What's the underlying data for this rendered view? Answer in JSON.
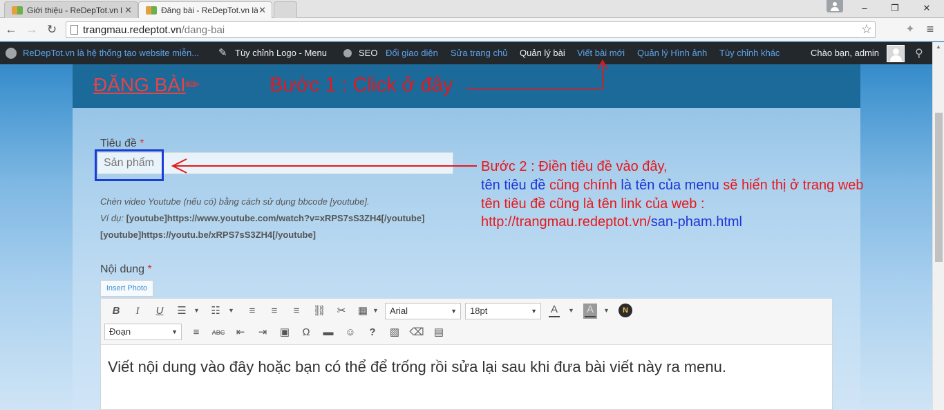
{
  "browser": {
    "tabs": [
      {
        "title": "Giới thiệu - ReDepTot.vn l"
      },
      {
        "title": "Đăng bài - ReDepTot.vn là"
      }
    ],
    "tab_close_glyph": "✕",
    "window_controls": {
      "minimize": "–",
      "restore": "❐",
      "close": "✕"
    },
    "url_host": "trangmau.redeptot.vn",
    "url_path": "/dang-bai"
  },
  "adminbar": {
    "site": "ReDepTot.vn là hệ thống tạo website miễn...",
    "logo_menu": "Tùy chỉnh Logo - Menu",
    "seo": "SEO",
    "theme": "Đổi giao diện",
    "edit_home": "Sửa trang chủ",
    "manage_posts": "Quản lý bài",
    "new_post": "Viết bài mới",
    "images": "Quản lý Hình ảnh",
    "other": "Tùy chỉnh khác",
    "greeting": "Chào bạn, admin"
  },
  "page": {
    "title": "ĐĂNG BÀI",
    "step1": "Bước 1 : Click ở đây"
  },
  "form": {
    "title_label": "Tiêu đề",
    "required_mark": "*",
    "title_placeholder": "Sản phẩm",
    "hint_line1": "Chèn video Youtube (nếu có) bằng cách sử dụng bbcode [youtube].",
    "hint_line2_prefix": "Ví dụ:",
    "hint_line2_code": "[youtube]https://www.youtube.com/watch?v=xRPS7sS3ZH4[/youtube]",
    "hint_line3_code": "[youtube]https://youtu.be/xRPS7sS3ZH4[/youtube]",
    "content_label": "Nội dung",
    "insert_photo": "Insert Photo"
  },
  "annotation": {
    "step2_line1": "Bước 2 : Điền tiêu đề vào đây,",
    "line2": [
      {
        "text": "tên tiêu đề",
        "color": "blue"
      },
      {
        "text": " cũng chính ",
        "color": "red"
      },
      {
        "text": "là tên của menu",
        "color": "blue"
      },
      {
        "text": " sẽ hiển thị ở trang web",
        "color": "red"
      }
    ],
    "line3": "tên tiêu đề cũng là tên link của web :",
    "line4_host": "http://trangmau.redeptot.vn/",
    "line4_slug": "san-pham.html"
  },
  "editor": {
    "font_family": "Arial",
    "font_size": "18pt",
    "format": "Đoạn",
    "n_badge": "N",
    "content": "Viết nội dung vào đây hoặc bạn có thể để trống rồi sửa lại sau khi đưa bài viết này ra menu."
  },
  "colors": {
    "annotation_red": "#e8171b",
    "annotation_blue": "#1d35d6",
    "adminbar_bg": "#23282d",
    "adminbar_link": "#5fa3e8",
    "header_bg": "#1b6a9a"
  }
}
